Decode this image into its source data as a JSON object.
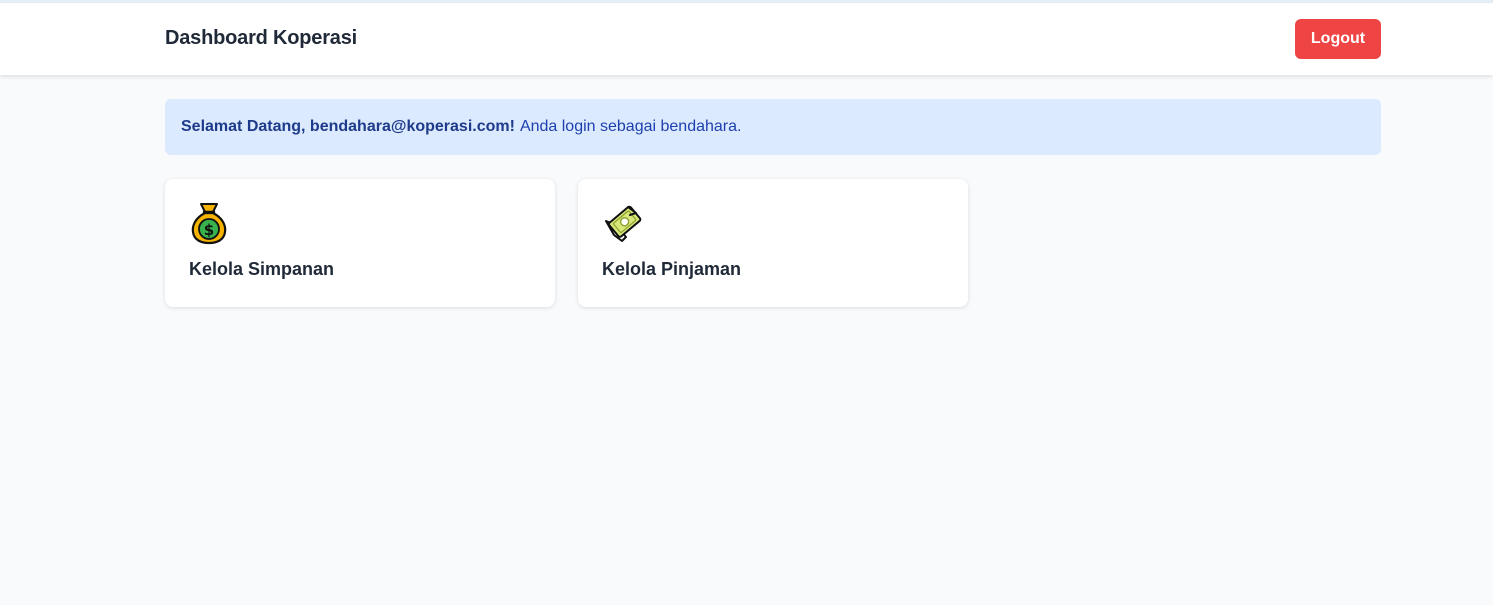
{
  "header": {
    "title": "Dashboard Koperasi",
    "logout_label": "Logout"
  },
  "welcome": {
    "greeting": "Selamat Datang, bendahara@koperasi.com!",
    "message": "Anda login sebagai bendahara."
  },
  "cards": [
    {
      "label": "Kelola Simpanan",
      "icon": "money-bag-icon"
    },
    {
      "label": "Kelola Pinjaman",
      "icon": "money-transfer-icon"
    }
  ],
  "colors": {
    "logout": "#ef4444",
    "alert_bg": "#dbeafe",
    "alert_text": "#1e40af",
    "page_bg": "#f8fafc"
  }
}
